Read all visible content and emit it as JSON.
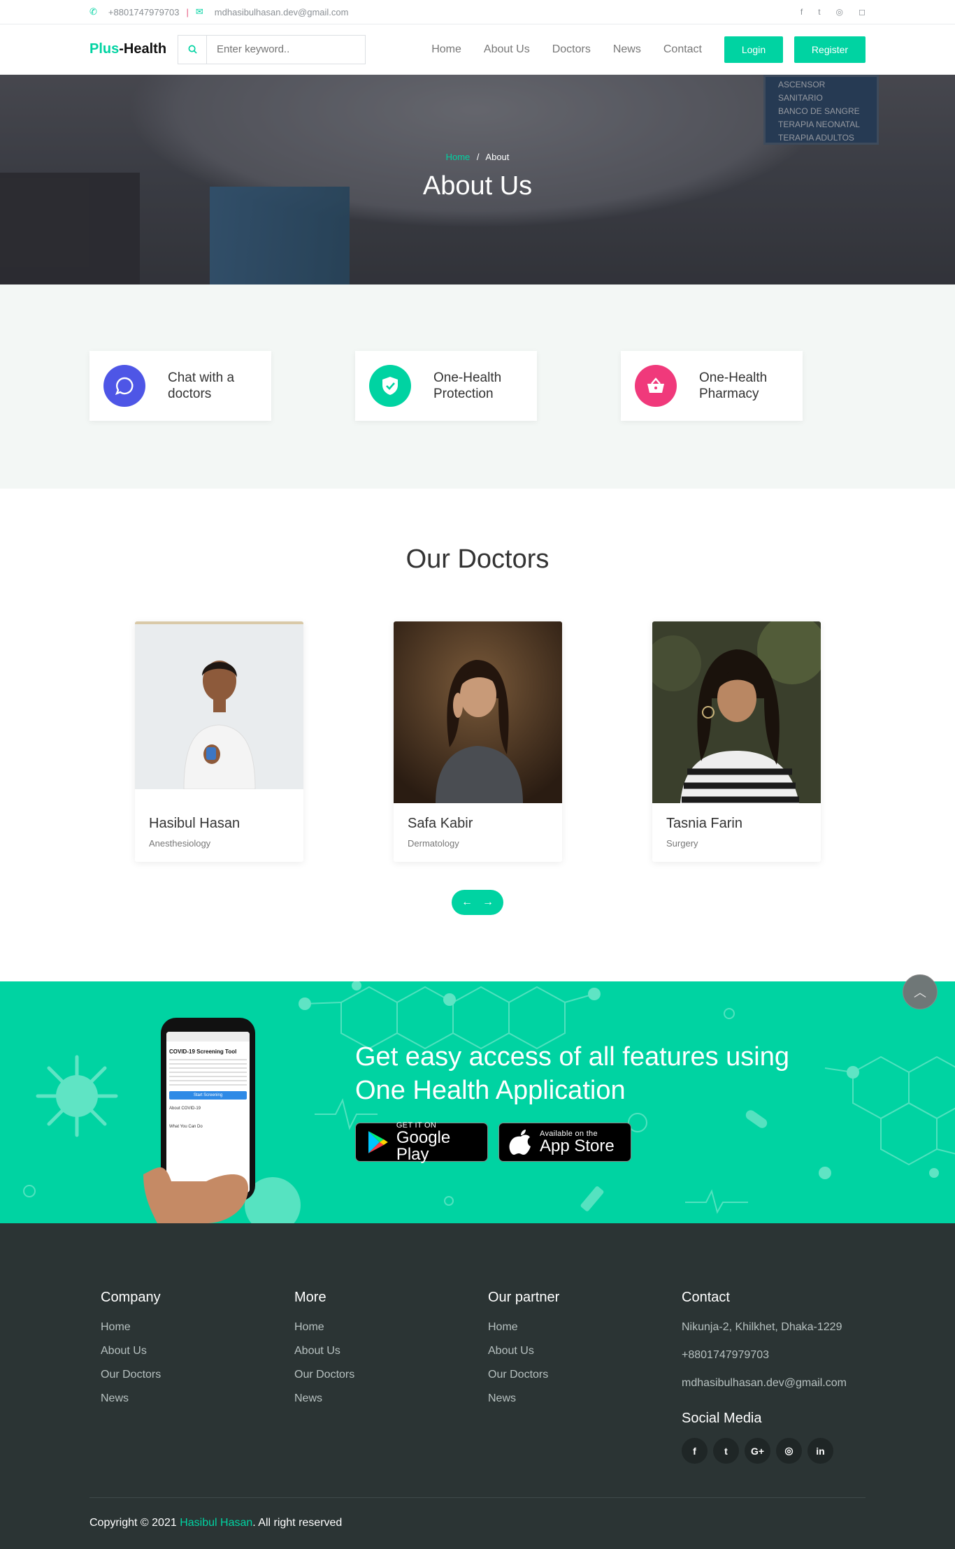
{
  "topbar": {
    "phone": "+8801747979703",
    "email": "mdhasibulhasan.dev@gmail.com"
  },
  "nav": {
    "logo_accent": "Plus",
    "logo_rest": "-Health",
    "search_placeholder": "Enter keyword..",
    "links": [
      "Home",
      "About Us",
      "Doctors",
      "News",
      "Contact"
    ],
    "login": "Login",
    "register": "Register"
  },
  "hero": {
    "breadcrumb_home": "Home",
    "breadcrumb_sep": "/",
    "breadcrumb_current": "About",
    "title": "About Us",
    "sign_lines": [
      "ASCENSOR",
      "SANITARIO",
      "BANCO DE SANGRE",
      "TERAPIA NEONATAL",
      "TERAPIA ADULTOS"
    ]
  },
  "features": [
    {
      "line1": "Chat with a",
      "line2": "doctors",
      "color": "#4e56e6",
      "icon": "chat-icon"
    },
    {
      "line1": "One-Health",
      "line2": "Protection",
      "color": "#00d3a2",
      "icon": "shield-check-icon"
    },
    {
      "line1": "One-Health",
      "line2": "Pharmacy",
      "color": "#f0397b",
      "icon": "basket-icon"
    }
  ],
  "doctors": {
    "title": "Our Doctors",
    "items": [
      {
        "name": "Hasibul Hasan",
        "specialty": "Anesthesiology"
      },
      {
        "name": "Safa Kabir",
        "specialty": "Dermatology"
      },
      {
        "name": "Tasnia Farin",
        "specialty": "Surgery"
      }
    ]
  },
  "app": {
    "headline1": "Get easy access of all features using",
    "headline2": "One Health Application",
    "google_small": "GET IT ON",
    "google_big": "Google Play",
    "apple_small": "Available on the",
    "apple_big": "App Store",
    "phone_title": "COVID-19 Screening Tool",
    "phone_btn": "Start Screening",
    "phone_item": "About COVID-19",
    "phone_item2": "What You Can Do"
  },
  "footer": {
    "columns": [
      {
        "title": "Company",
        "links": [
          "Home",
          "About Us",
          "Our Doctors",
          "News"
        ]
      },
      {
        "title": "More",
        "links": [
          "Home",
          "About Us",
          "Our Doctors",
          "News"
        ]
      },
      {
        "title": "Our partner",
        "links": [
          "Home",
          "About Us",
          "Our Doctors",
          "News"
        ]
      }
    ],
    "contact_title": "Contact",
    "address": "Nikunja-2, Khilkhet, Dhaka-1229",
    "phone": "+8801747979703",
    "email": "mdhasibulhasan.dev@gmail.com",
    "social_title": "Social Media",
    "copy_pre": "Copyright © 2021 ",
    "copy_name": "Hasibul Hasan",
    "copy_post": ". All right reserved"
  },
  "colors": {
    "accent": "#00d3a2",
    "footer_bg": "#2b3434"
  }
}
